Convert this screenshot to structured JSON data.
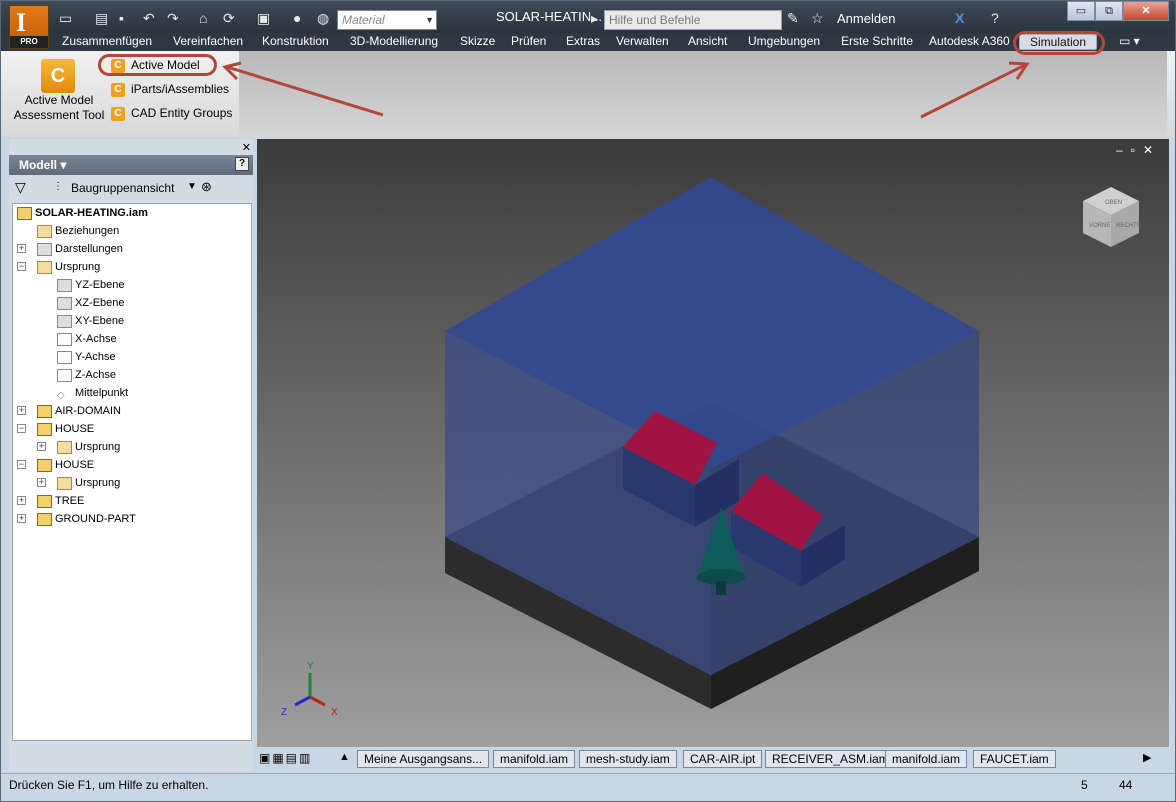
{
  "app": {
    "badge": "I",
    "edition": "PRO"
  },
  "title_bar": {
    "document_title": "SOLAR-HEATIN...",
    "material_placeholder": "Material",
    "search_placeholder": "Hilfe und Befehle durchsuchen...",
    "sign_in": "Anmelden",
    "window_controls": {
      "minimize": "▭",
      "restore": "⧉",
      "close": "✕"
    }
  },
  "menu": {
    "items": [
      "Zusammenfügen",
      "Vereinfachen",
      "Konstruktion",
      "3D-Modellierung",
      "Skizze",
      "Prüfen",
      "Extras",
      "Verwalten",
      "Ansicht",
      "Umgebungen",
      "Erste Schritte",
      "Autodesk A360",
      "Simulation"
    ],
    "active": "Simulation"
  },
  "ribbon": {
    "big_button": "Active Model Assessment Tool",
    "big_icon": "C",
    "small_buttons": [
      "Active Model",
      "iParts/iAssemblies",
      "CAD Entity Groups"
    ],
    "small_icon": "C"
  },
  "browser": {
    "title": "Modell ▾",
    "help_icon": "?",
    "view_mode": "Baugruppenansicht",
    "tree": [
      {
        "label": "SOLAR-HEATING.iam",
        "icon": "assembly-icon"
      },
      {
        "label": "Beziehungen",
        "icon": "folder-icon"
      },
      {
        "label": "Darstellungen",
        "icon": "representations-icon"
      },
      {
        "label": "Ursprung",
        "icon": "folder-open-icon"
      },
      {
        "label": "YZ-Ebene",
        "icon": "plane-icon"
      },
      {
        "label": "XZ-Ebene",
        "icon": "plane-icon"
      },
      {
        "label": "XY-Ebene",
        "icon": "plane-icon"
      },
      {
        "label": "X-Achse",
        "icon": "axis-icon"
      },
      {
        "label": "Y-Achse",
        "icon": "axis-icon"
      },
      {
        "label": "Z-Achse",
        "icon": "axis-icon"
      },
      {
        "label": "Mittelpunkt",
        "icon": "point-icon"
      },
      {
        "label": "AIR-DOMAIN",
        "icon": "part-icon"
      },
      {
        "label": "HOUSE",
        "icon": "part-icon"
      },
      {
        "label": "Ursprung",
        "icon": "folder-icon"
      },
      {
        "label": "HOUSE",
        "icon": "part-icon"
      },
      {
        "label": "Ursprung",
        "icon": "folder-icon"
      },
      {
        "label": "TREE",
        "icon": "part-icon"
      },
      {
        "label": "GROUND-PART",
        "icon": "part-icon"
      }
    ]
  },
  "viewcube": {
    "faces": [
      "OBEN",
      "VORNE",
      "RECHTS"
    ]
  },
  "triad": {
    "x": "X",
    "y": "Y",
    "z": "Z"
  },
  "doc_tabs": [
    "Meine Ausgangsans...",
    "manifold.iam",
    "mesh-study.iam",
    "CAR-AIR.ipt",
    "RECEIVER_ASM.iam",
    "manifold.iam",
    "FAUCET.iam"
  ],
  "status": {
    "hint": "Drücken Sie F1, um Hilfe zu erhalten.",
    "count_a": "5",
    "count_b": "44"
  },
  "colors": {
    "accent_annotation": "#b4453a",
    "roof": "#a01040",
    "air_domain": "#2f4690",
    "tree": "#0f5a5a"
  }
}
